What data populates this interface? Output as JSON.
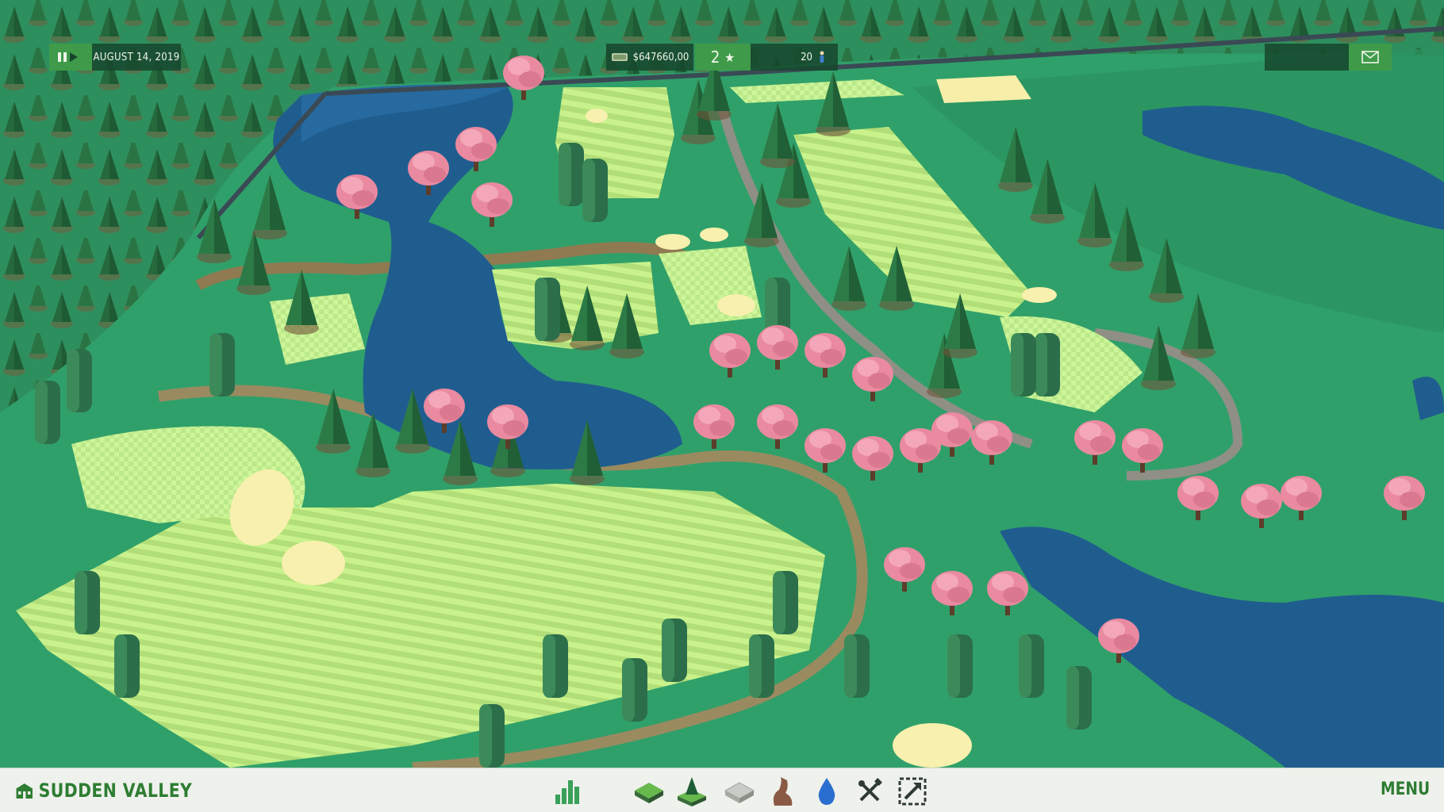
{
  "hud": {
    "date": "AUGUST 14, 2019",
    "money": "$647660,00",
    "stars": "2",
    "golfers": "20"
  },
  "bottom": {
    "course_name": "SUDDEN VALLEY",
    "menu_label": "MENU",
    "tools": [
      "stats-icon",
      "terrain-icon",
      "trees-icon",
      "grid-icon",
      "wall-icon",
      "water-icon",
      "tools-icon",
      "expand-icon"
    ]
  },
  "colors": {
    "grass": "#2f9a68",
    "fairway_light": "#c7f08a",
    "fairway_dark": "#b3e07a",
    "water": "#1f5d8f",
    "pine": "#2b7a45",
    "cherry": "#e98aa0",
    "sand": "#f7eeaa",
    "path": "#9b9b7a",
    "ui_green": "#2e7d32"
  }
}
